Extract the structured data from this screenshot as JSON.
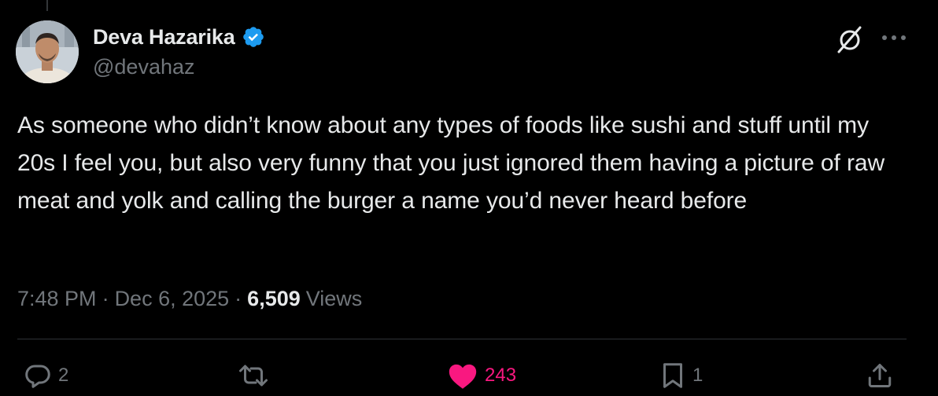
{
  "author": {
    "display_name": "Deva Hazarika",
    "handle": "@devahaz",
    "verified": true,
    "verified_color": "#1d9bf0"
  },
  "header_icons": {
    "grok": "grok-icon",
    "more": "more-icon"
  },
  "tweet": {
    "text": "As someone who didn’t know about any types of foods like sushi and stuff until my 20s I feel you, but also very funny that you just ignored them having a picture of raw meat and yolk and calling the burger a name you’d never heard before"
  },
  "meta": {
    "time": "7:48 PM",
    "separator": "·",
    "date": "Dec 6, 2025",
    "views_count": "6,509",
    "views_label": "Views"
  },
  "actions": {
    "reply": {
      "icon": "reply-icon",
      "count": "2"
    },
    "retweet": {
      "icon": "retweet-icon",
      "count": ""
    },
    "like": {
      "icon": "heart-filled-icon",
      "count": "243",
      "active": true,
      "color": "#f91880"
    },
    "bookmark": {
      "icon": "bookmark-icon",
      "count": "1"
    },
    "share": {
      "icon": "share-icon"
    }
  },
  "colors": {
    "background": "#000000",
    "text_primary": "#e7e9ea",
    "text_secondary": "#71767b",
    "divider": "#2f3336"
  }
}
